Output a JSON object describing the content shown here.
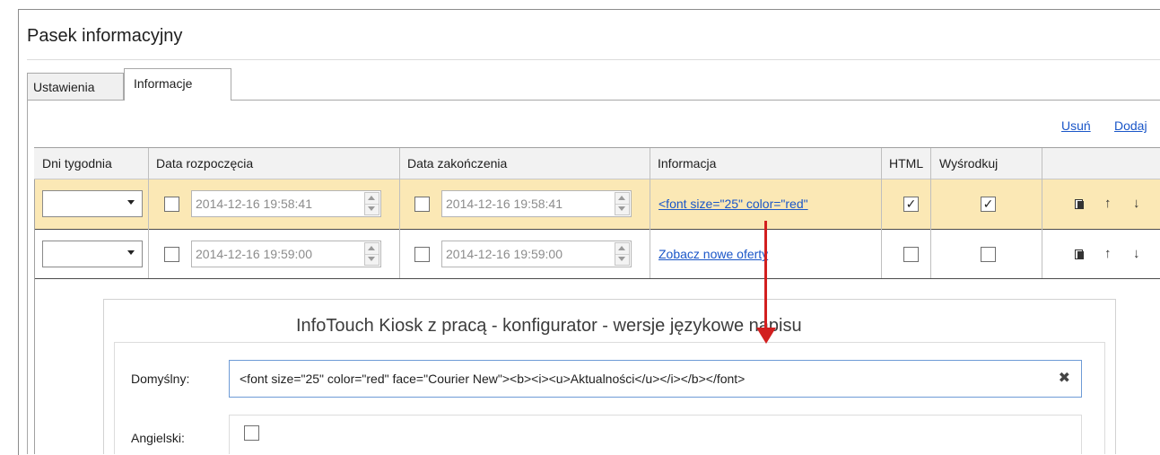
{
  "window": {
    "title": "Pasek informacyjny"
  },
  "tabs": [
    {
      "label": "Ustawienia",
      "active": false
    },
    {
      "label": "Informacje",
      "active": true
    }
  ],
  "actions": {
    "delete": "Usuń",
    "add": "Dodaj"
  },
  "columns": [
    "Dni tygodnia",
    "Data rozpoczęcia",
    "Data zakończenia",
    "Informacja",
    "HTML",
    "Wyśrodkuj"
  ],
  "rows": [
    {
      "day": "",
      "start_enabled": false,
      "start": "2014-12-16 19:58:41",
      "end_enabled": false,
      "end": "2014-12-16 19:58:41",
      "info": "<font size=\"25\" color=\"red\"",
      "html": true,
      "center": true,
      "selected": true
    },
    {
      "day": "",
      "start_enabled": false,
      "start": "2014-12-16 19:59:00",
      "end_enabled": false,
      "end": "2014-12-16 19:59:00",
      "info": "Zobacz nowe oferty",
      "html": false,
      "center": false,
      "selected": false
    }
  ],
  "row_icons": {
    "copy": "copy-icon",
    "up": "↑",
    "down": "↓"
  },
  "dialog": {
    "title": "InfoTouch Kiosk z pracą - konfigurator - wersje językowe napisu",
    "default_label": "Domyślny:",
    "default_value": "<font size=\"25\" color=\"red\" face=\"Courier New\"><b><i><u>Aktualności</u></i></b></font>",
    "clear_glyph": "✖",
    "english_label": "Angielski:",
    "english_checked": false
  },
  "colors": {
    "selected_row": "#fbe8b5",
    "link": "#1a56c8",
    "annotation_arrow": "#d21f1f"
  }
}
